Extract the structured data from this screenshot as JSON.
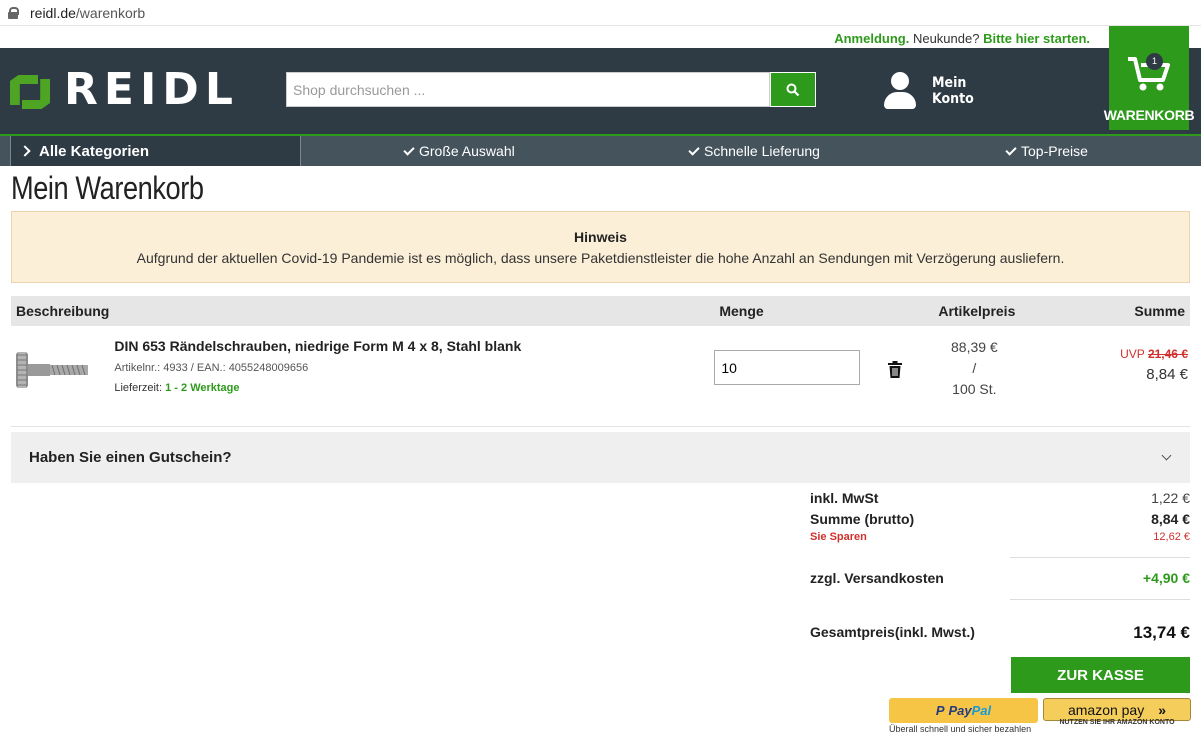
{
  "browser": {
    "host": "reidl.de",
    "path": "/warenkorb"
  },
  "topbar": {
    "login": "Anmeldung.",
    "new_customer": "Neukunde?",
    "register": "Bitte hier starten."
  },
  "header": {
    "logo_text": "REIDL",
    "search_placeholder": "Shop durchsuchen ...",
    "account_line1": "Mein",
    "account_line2": "Konto",
    "cart_label": "WARENKORB",
    "cart_count": "1"
  },
  "nav": {
    "categories": "Alle Kategorien",
    "usp": [
      "Große Auswahl",
      "Schnelle Lieferung",
      "Top-Preise"
    ]
  },
  "page_title": "Mein Warenkorb",
  "notice": {
    "heading": "Hinweis",
    "text": "Aufgrund der aktuellen Covid-19 Pandemie ist es möglich, dass unsere Paketdienstleister die hohe Anzahl an Sendungen mit Verzögerung ausliefern."
  },
  "table": {
    "headers": {
      "desc": "Beschreibung",
      "qty": "Menge",
      "price": "Artikelpreis",
      "sum": "Summe"
    },
    "items": [
      {
        "name": "DIN 653 Rändelschrauben, niedrige Form M 4 x 8, Stahl blank",
        "meta": "Artikelnr.: 4933 / EAN.: 4055248009656",
        "delivery_label": "Lieferzeit:",
        "delivery_value": "1 - 2 Werktage",
        "quantity": "10",
        "unit_price": "88,39 €",
        "unit_sep": "/",
        "unit_amount": "100 St.",
        "uvp_label": "UVP",
        "uvp_price": "21,46 €",
        "sum": "8,84 €"
      }
    ]
  },
  "coupon": {
    "label": "Haben Sie einen Gutschein?"
  },
  "totals": {
    "vat_label": "inkl. MwSt",
    "vat": "1,22 €",
    "gross_label": "Summe (brutto)",
    "gross": "8,84 €",
    "save_label": "Sie Sparen",
    "save": "12,62 €",
    "shipping_label": "zzgl. Versandkosten",
    "shipping": "+4,90 €",
    "total_label": "Gesamtpreis(inkl. Mwst.)",
    "total": "13,74 €"
  },
  "checkout": {
    "label": "ZUR KASSE"
  },
  "paypal": {
    "brand1": "Pay",
    "brand2": "Pal",
    "caption": "Überall schnell und sicher bezahlen"
  },
  "amazon": {
    "brand": "amazon pay",
    "arrows": "»",
    "caption": "NUTZEN SIE IHR AMAZON KONTO"
  },
  "colors": {
    "brand_green": "#2e9a1c",
    "header_dark": "#2f3b44",
    "price_red": "#d0312d"
  }
}
